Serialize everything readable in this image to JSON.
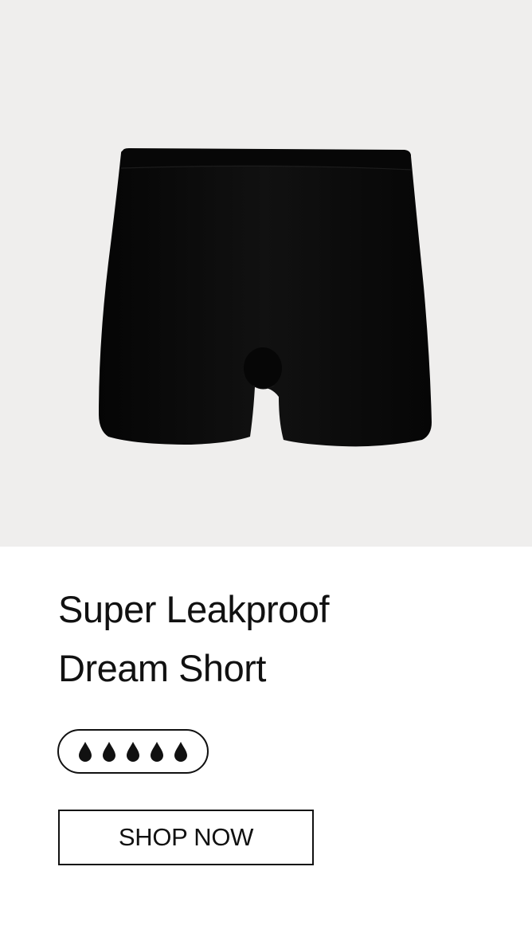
{
  "product": {
    "title_line_1": "Super Leakproof",
    "title_line_2": "Dream Short",
    "absorbency": {
      "level": 5,
      "max": 5,
      "icon": "drop-icon"
    },
    "shop_button_label": "SHOP NOW"
  },
  "colors": {
    "image_background": "#efeeed",
    "garment": "#0d0d0d",
    "text": "#111111",
    "page_background": "#ffffff"
  }
}
